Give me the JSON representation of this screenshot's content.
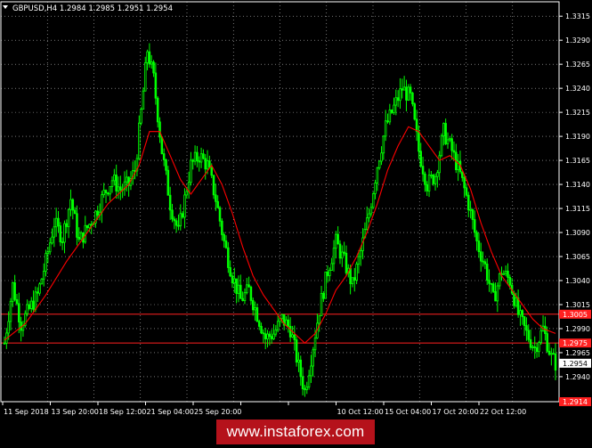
{
  "header": {
    "symbol_line": "GBPUSD,H4  1.2984 1.2985 1.2951 1.2954"
  },
  "watermark": {
    "text": "www.instaforex.com"
  },
  "colors": {
    "background": "#000000",
    "candles": "#00ff00",
    "moving_average": "#ff0000",
    "level_lines": "#ff2020",
    "grid": "#c0c0c0",
    "axis_text": "#ffffff",
    "watermark_bg": "#b5121b"
  },
  "chart_data": {
    "type": "candlestick",
    "ylim": [
      1.2914,
      1.333
    ],
    "grid": true,
    "y_ticks": [
      "1.3315",
      "1.3290",
      "1.3265",
      "1.3240",
      "1.3215",
      "1.3190",
      "1.3165",
      "1.3140",
      "1.3115",
      "1.3090",
      "1.3065",
      "1.3040",
      "1.3015",
      "1.2990",
      "1.2965",
      "1.2940"
    ],
    "x_ticks": [
      "11 Sep 2018",
      "13 Sep 20:00",
      "18 Sep 12:00",
      "21 Sep 04:00",
      "25 Sep 20:00",
      "",
      "",
      "10 Oct 12:00",
      "15 Oct 04:00",
      "17 Oct 20:00",
      "22 Oct 12:00"
    ],
    "level_lines": [
      {
        "value": 1.3005,
        "label": "1.3005"
      },
      {
        "value": 1.2975,
        "label": "1.2975"
      },
      {
        "value": 1.2914,
        "label": "1.2914"
      }
    ],
    "current_price": {
      "value": 1.2954,
      "label": "1.2954"
    },
    "price_path": [
      [
        0,
        1.2975
      ],
      [
        4,
        1.3035
      ],
      [
        8,
        1.2995
      ],
      [
        12,
        1.301
      ],
      [
        16,
        1.3025
      ],
      [
        20,
        1.306
      ],
      [
        24,
        1.31
      ],
      [
        28,
        1.3085
      ],
      [
        32,
        1.3125
      ],
      [
        36,
        1.308
      ],
      [
        40,
        1.3095
      ],
      [
        44,
        1.311
      ],
      [
        48,
        1.313
      ],
      [
        52,
        1.3145
      ],
      [
        56,
        1.3135
      ],
      [
        60,
        1.314
      ],
      [
        63,
        1.3155
      ],
      [
        66,
        1.3215
      ],
      [
        69,
        1.328
      ],
      [
        72,
        1.325
      ],
      [
        76,
        1.3175
      ],
      [
        80,
        1.312
      ],
      [
        84,
        1.309
      ],
      [
        87,
        1.3125
      ],
      [
        90,
        1.316
      ],
      [
        94,
        1.317
      ],
      [
        98,
        1.316
      ],
      [
        102,
        1.3125
      ],
      [
        106,
        1.308
      ],
      [
        110,
        1.3045
      ],
      [
        114,
        1.302
      ],
      [
        118,
        1.303
      ],
      [
        122,
        1.3005
      ],
      [
        126,
        1.298
      ],
      [
        130,
        1.2985
      ],
      [
        134,
        1.3
      ],
      [
        138,
        1.299
      ],
      [
        142,
        1.295
      ],
      [
        145,
        1.2925
      ],
      [
        148,
        1.296
      ],
      [
        152,
        1.301
      ],
      [
        156,
        1.305
      ],
      [
        160,
        1.308
      ],
      [
        164,
        1.306
      ],
      [
        168,
        1.3035
      ],
      [
        172,
        1.307
      ],
      [
        176,
        1.311
      ],
      [
        180,
        1.316
      ],
      [
        184,
        1.32
      ],
      [
        188,
        1.322
      ],
      [
        192,
        1.324
      ],
      [
        196,
        1.323
      ],
      [
        200,
        1.3175
      ],
      [
        204,
        1.314
      ],
      [
        208,
        1.315
      ],
      [
        212,
        1.3195
      ],
      [
        216,
        1.3175
      ],
      [
        220,
        1.315
      ],
      [
        224,
        1.312
      ],
      [
        228,
        1.308
      ],
      [
        232,
        1.3055
      ],
      [
        236,
        1.302
      ],
      [
        240,
        1.305
      ],
      [
        244,
        1.304
      ],
      [
        248,
        1.3005
      ],
      [
        252,
        1.2985
      ],
      [
        256,
        1.297
      ],
      [
        260,
        1.299
      ],
      [
        264,
        1.296
      ],
      [
        266,
        1.2954
      ]
    ],
    "moving_average": [
      [
        0,
        1.2978
      ],
      [
        10,
        1.2995
      ],
      [
        20,
        1.3025
      ],
      [
        30,
        1.306
      ],
      [
        40,
        1.309
      ],
      [
        50,
        1.312
      ],
      [
        60,
        1.314
      ],
      [
        65,
        1.316
      ],
      [
        70,
        1.3195
      ],
      [
        75,
        1.3195
      ],
      [
        80,
        1.317
      ],
      [
        85,
        1.3145
      ],
      [
        90,
        1.313
      ],
      [
        95,
        1.3145
      ],
      [
        100,
        1.316
      ],
      [
        105,
        1.314
      ],
      [
        110,
        1.311
      ],
      [
        115,
        1.3075
      ],
      [
        120,
        1.3045
      ],
      [
        125,
        1.3025
      ],
      [
        130,
        1.301
      ],
      [
        135,
        1.2995
      ],
      [
        140,
        1.2985
      ],
      [
        145,
        1.2975
      ],
      [
        150,
        1.2985
      ],
      [
        155,
        1.3005
      ],
      [
        160,
        1.303
      ],
      [
        165,
        1.3045
      ],
      [
        170,
        1.3065
      ],
      [
        175,
        1.309
      ],
      [
        180,
        1.312
      ],
      [
        185,
        1.3155
      ],
      [
        190,
        1.318
      ],
      [
        195,
        1.32
      ],
      [
        200,
        1.3195
      ],
      [
        205,
        1.318
      ],
      [
        210,
        1.3165
      ],
      [
        215,
        1.317
      ],
      [
        220,
        1.316
      ],
      [
        225,
        1.3135
      ],
      [
        230,
        1.31
      ],
      [
        235,
        1.307
      ],
      [
        240,
        1.3045
      ],
      [
        245,
        1.303
      ],
      [
        250,
        1.3015
      ],
      [
        255,
        1.3
      ],
      [
        260,
        1.299
      ],
      [
        266,
        1.2985
      ]
    ]
  }
}
